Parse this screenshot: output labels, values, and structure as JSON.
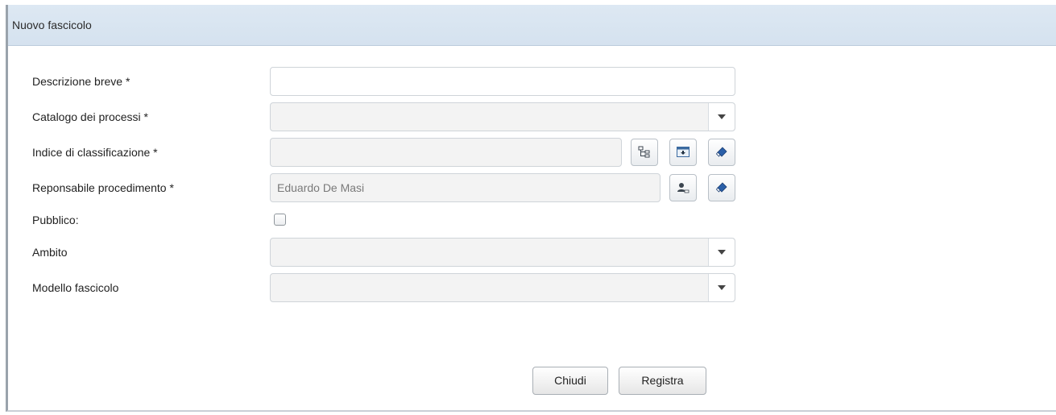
{
  "window": {
    "title": "Nuovo fascicolo"
  },
  "form": {
    "descrizione_breve": {
      "label": "Descrizione breve *",
      "value": ""
    },
    "catalogo_processi": {
      "label": "Catalogo dei processi *",
      "selected": ""
    },
    "indice_classificazione": {
      "label": "Indice di classificazione *",
      "value": "",
      "icons": [
        "tree-icon",
        "browse-icon",
        "eraser-icon"
      ]
    },
    "responsabile_procedimento": {
      "label": "Reponsabile procedimento *",
      "value": "Eduardo De Masi",
      "icons": [
        "user-search-icon",
        "eraser-icon"
      ]
    },
    "pubblico": {
      "label": "Pubblico:",
      "checked": false
    },
    "ambito": {
      "label": "Ambito",
      "selected": ""
    },
    "modello_fascicolo": {
      "label": "Modello fascicolo",
      "selected": ""
    }
  },
  "actions": {
    "close_label": "Chiudi",
    "register_label": "Registra"
  },
  "colors": {
    "titlebar": "#d9e5f1",
    "border": "#cfd4d9",
    "readonly_bg": "#f3f3f3",
    "eraser_blue": "#2a5fa8"
  }
}
